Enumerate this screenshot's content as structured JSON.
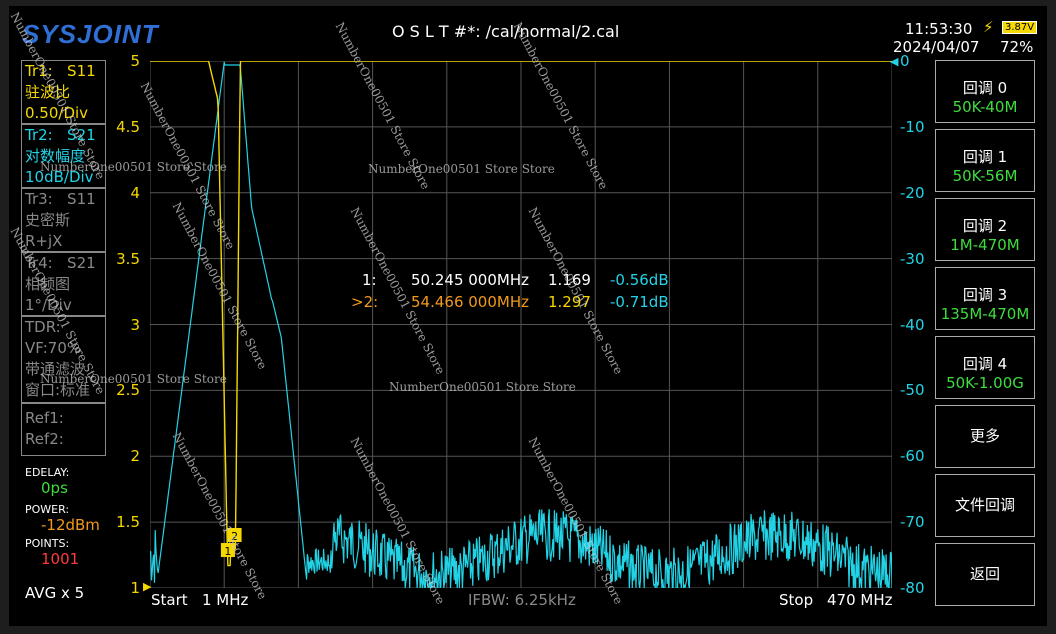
{
  "header": {
    "logo": "SYSJOINT",
    "file": "O S L T #*:    /cal/normal/2.cal",
    "time": "11:53:30",
    "date": "2024/04/07",
    "battery_voltage": "3.87V",
    "battery_percent": "72%"
  },
  "traces": [
    {
      "id": "Tr1:",
      "param": "S11",
      "format": "驻波比",
      "scale": "0.50/Div",
      "active": true,
      "color": "#f5d800"
    },
    {
      "id": "Tr2:",
      "param": "S21",
      "format": "对数幅度",
      "scale": "10dB/Div",
      "active": true,
      "color": "#22d3e6"
    },
    {
      "id": "Tr3:",
      "param": "S11",
      "format": "史密斯",
      "scale": "R+jX",
      "active": false
    },
    {
      "id": "Tr4:",
      "param": "S21",
      "format": "相频图",
      "scale": "1°/Div",
      "active": false
    }
  ],
  "tdr": {
    "title": "TDR:",
    "vf": "VF:70%",
    "mode": "带通滤波",
    "window": "窗口:标准"
  },
  "refs": {
    "ref1": "Ref1:",
    "ref2": "Ref2:"
  },
  "params": {
    "edelay_label": "EDELAY:",
    "edelay_value": "0ps",
    "power_label": "POWER:",
    "power_value": "-12dBm",
    "points_label": "POINTS:",
    "points_value": "1001",
    "avg": "AVG x 5"
  },
  "left_axis": [
    "5",
    "4.5",
    "4",
    "3.5",
    "3",
    "2.5",
    "2",
    "1.5",
    "1"
  ],
  "right_axis": [
    "0",
    "-10",
    "-20",
    "-30",
    "-40",
    "-50",
    "-60",
    "-70",
    "-80"
  ],
  "markers": [
    {
      "id": "1:",
      "freq": "50.245 000MHz",
      "swr": "1.169",
      "db": "-0.56dB"
    },
    {
      "id": ">2:",
      "freq": "54.466 000MHz",
      "swr": "1.297",
      "db": "-0.71dB"
    }
  ],
  "footer": {
    "start_label": "Start",
    "start_value": "1 MHz",
    "ifbw": "IFBW: 6.25kHz",
    "stop_label": "Stop",
    "stop_value": "470 MHz"
  },
  "softkeys": [
    {
      "label": "回调 0",
      "sub": "50K-40M"
    },
    {
      "label": "回调 1",
      "sub": "50K-56M"
    },
    {
      "label": "回调 2",
      "sub": "1M-470M"
    },
    {
      "label": "回调 3",
      "sub": "135M-470M"
    },
    {
      "label": "回调 4",
      "sub": "50K-1.00G"
    },
    {
      "label": "更多"
    },
    {
      "label": "文件回调"
    },
    {
      "label": "返回"
    }
  ],
  "watermark": "NumberOne00501 Store Store",
  "colors": {
    "swr": "#f5d800",
    "logmag": "#22d3e6",
    "grid": "#555555",
    "button_sub": "#3fdc3f"
  }
}
